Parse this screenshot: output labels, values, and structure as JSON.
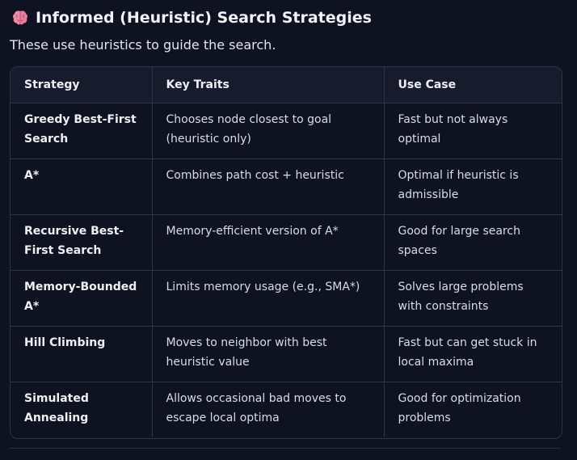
{
  "header": {
    "title": "Informed (Heuristic) Search Strategies",
    "icon": "brain-icon",
    "subtitle": "These use heuristics to guide the search."
  },
  "colors": {
    "background": "#0f1220",
    "header_row": "#171b2b",
    "border": "#2f3445",
    "icon_pink": "#f08aa8"
  },
  "table": {
    "columns": [
      "Strategy",
      "Key Traits",
      "Use Case"
    ],
    "rows": [
      {
        "strategy": "Greedy Best-First Search",
        "traits": "Chooses node closest to goal (heuristic only)",
        "use_case": "Fast but not always optimal"
      },
      {
        "strategy": "A*",
        "traits": "Combines path cost + heuristic",
        "use_case": "Optimal if heuristic is admissible"
      },
      {
        "strategy": "Recursive Best-First Search",
        "traits": "Memory-efficient version of A*",
        "use_case": "Good for large search spaces"
      },
      {
        "strategy": "Memory-Bounded A*",
        "traits": "Limits memory usage (e.g., SMA*)",
        "use_case": "Solves large problems with constraints"
      },
      {
        "strategy": "Hill Climbing",
        "traits": "Moves to neighbor with best heuristic value",
        "use_case": "Fast but can get stuck in local maxima"
      },
      {
        "strategy": "Simulated Annealing",
        "traits": "Allows occasional bad moves to escape local optima",
        "use_case": "Good for optimization problems"
      }
    ]
  }
}
